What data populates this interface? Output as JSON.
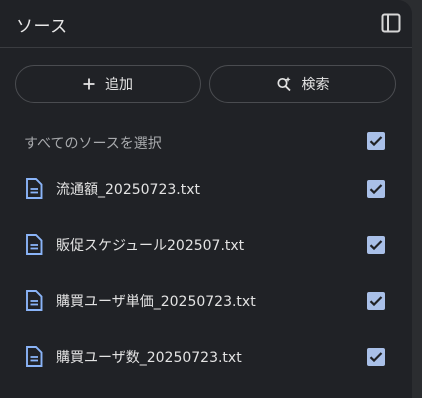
{
  "panel": {
    "title": "ソース"
  },
  "actions": {
    "add_label": "追加",
    "search_label": "検索"
  },
  "select_all": {
    "label": "すべてのソースを選択",
    "checked": true
  },
  "sources": [
    {
      "name": "流通額_20250723.txt",
      "checked": true
    },
    {
      "name": "販促スケジュール202507.txt",
      "checked": true
    },
    {
      "name": "購買ユーザ単価_20250723.txt",
      "checked": true
    },
    {
      "name": "購買ユーザ数_20250723.txt",
      "checked": true
    }
  ],
  "colors": {
    "accent_checkbox": "#a9c0e8",
    "file_icon": "#8ab4f8",
    "panel_bg": "#202226"
  }
}
